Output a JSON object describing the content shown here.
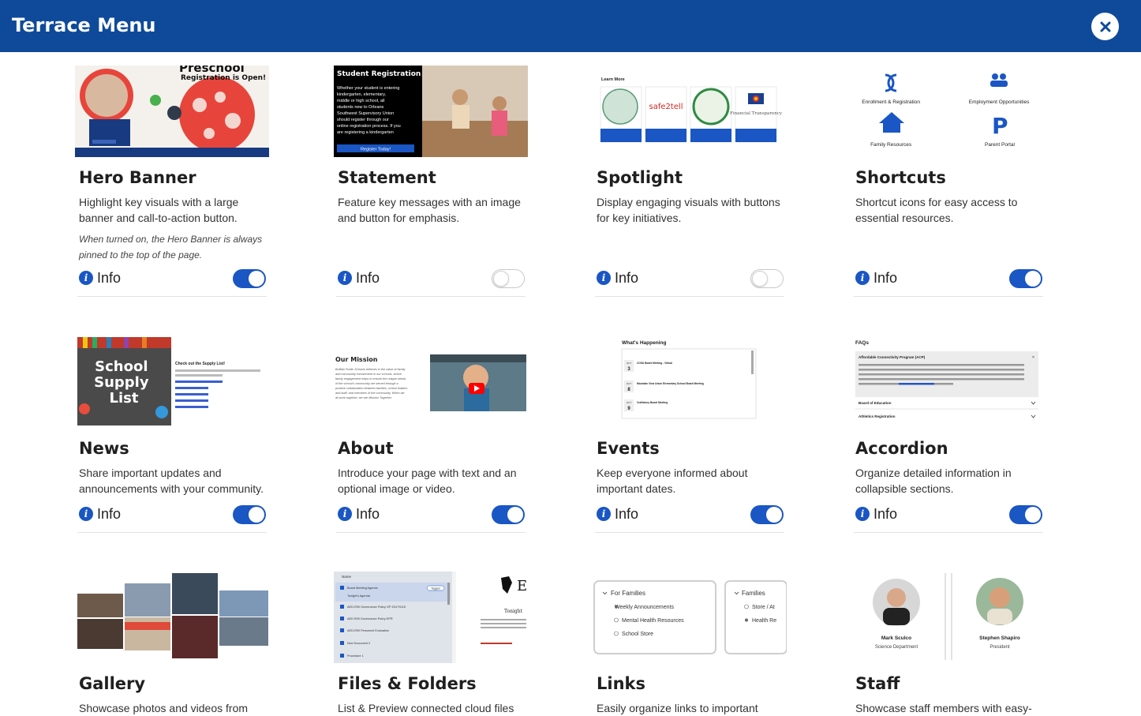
{
  "header": {
    "title": "Terrace Menu"
  },
  "info_label": "Info",
  "colors": {
    "header_bg": "#0f4a9a",
    "accent": "#1a56c4"
  },
  "cards": [
    {
      "title": "Hero Banner",
      "description": "Highlight key visuals with a large banner and call-to-action button.",
      "note": "When turned on, the Hero Banner is always pinned to the top of the page.",
      "enabled": true
    },
    {
      "title": "Statement",
      "description": "Feature key messages with an image and button for emphasis.",
      "enabled": false
    },
    {
      "title": "Spotlight",
      "description": "Display engaging visuals with buttons for key initiatives.",
      "enabled": false
    },
    {
      "title": "Shortcuts",
      "description": "Shortcut icons for easy access to essential resources.",
      "enabled": true
    },
    {
      "title": "News",
      "description": "Share important updates and announcements with your community.",
      "enabled": true
    },
    {
      "title": "About",
      "description": "Introduce your page with text and an optional image or video.",
      "enabled": true
    },
    {
      "title": "Events",
      "description": "Keep everyone informed about important dates.",
      "enabled": true
    },
    {
      "title": "Accordion",
      "description": "Organize detailed information in collapsible sections.",
      "enabled": true
    },
    {
      "title": "Gallery",
      "description": "Showcase photos and videos from"
    },
    {
      "title": "Files & Folders",
      "description": "List & Preview connected cloud files"
    },
    {
      "title": "Links",
      "description": "Easily organize links to important"
    },
    {
      "title": "Staff",
      "description": "Showcase staff members with easy-"
    }
  ],
  "thumbs": {
    "hero": {
      "headline": "Preschool",
      "sub": "Registration is Open!"
    },
    "statement": {
      "title": "Student Registration",
      "body": [
        "Whether your student is entering",
        "kindergarten, elementary,",
        "middle or high school, all",
        "students new to Orleans",
        "Southwest Supervisory Union",
        "should register through our",
        "online registration process. If you",
        "are registering a kindergarten"
      ],
      "button": "Register Today!"
    },
    "spotlight": {
      "heading": "Learn More",
      "logos": [
        "safe2tell",
        "Financial Transparency"
      ]
    },
    "shortcuts": {
      "items": [
        "Enrollment & Registration",
        "Employment Opportunities",
        "Family Resources",
        "Parent Portal"
      ]
    },
    "news": {
      "image_text": [
        "School",
        "Supply",
        "List"
      ],
      "heading": "Check out the Supply List!"
    },
    "about": {
      "heading": "Our Mission",
      "text": [
        "Buffalo Public Schools believes in the value of family",
        "and community involvement in our schools. Active",
        "family engagement helps to ensure the unique needs",
        "of the school's community are served through a",
        "positive collaboration between families, school leaders",
        "and staff, and members of the community. When we",
        "all work together, we are Mission Together."
      ]
    },
    "events": {
      "heading": "What's Happening",
      "month": "OCT",
      "days": [
        "3",
        "8",
        "9"
      ],
      "items": [
        "COSU Board Meeting - Virtual",
        "Mountain View Union Elementary School Board Meeting",
        "Craftsbury Board Meeting"
      ]
    },
    "accordion": {
      "heading": "FAQs",
      "open_item": "Affordable Connectivity Program (ACP)",
      "items": [
        "Board of Education",
        "Athletics Registration"
      ]
    },
    "files": {
      "column": "Name",
      "rows": [
        "Board Meeting Agenda",
        "Tonight's Agenda",
        "AED-R09 Governance Policy GP Z04 ROLE",
        "AED R09 Governance Policy EPR",
        "AED-R09 Personnel Evaluation",
        "New Document 2",
        "Procedure 1"
      ],
      "badge": "Tagged",
      "side_title": "Tonight"
    },
    "links": {
      "groups": [
        {
          "title": "For Families",
          "items": [
            "Weekly Announcements",
            "Mental Health Resources",
            "School Store"
          ]
        },
        {
          "title": "Families",
          "items": [
            "Store / At",
            "Health Re"
          ]
        }
      ]
    },
    "staff": {
      "people": [
        {
          "name": "Mark Sculco",
          "role": "Science Department"
        },
        {
          "name": "Stephen Shapiro",
          "role": "President"
        }
      ]
    }
  }
}
